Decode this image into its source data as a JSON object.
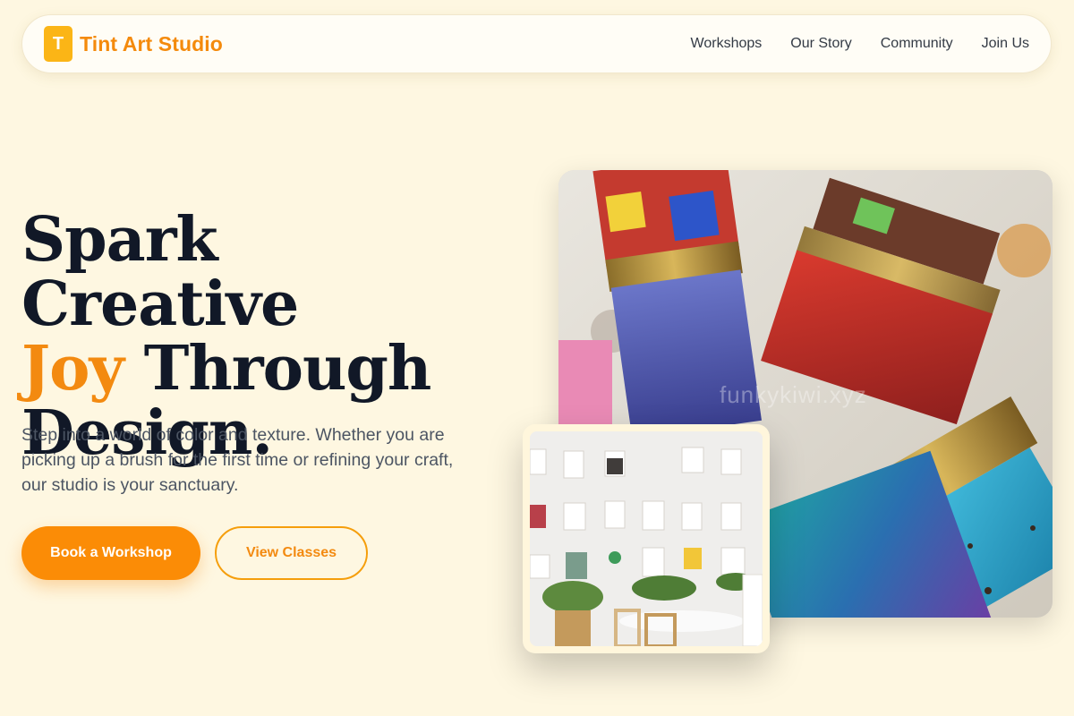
{
  "header": {
    "logo_letter": "T",
    "brand_name": "Tint Art Studio",
    "nav": [
      {
        "label": "Workshops"
      },
      {
        "label": "Our Story"
      },
      {
        "label": "Community"
      },
      {
        "label": "Join Us"
      }
    ]
  },
  "hero": {
    "title_line1": "Spark Creative",
    "title_accent": "Joy",
    "title_line2_rest": " Through",
    "title_line3": "Design.",
    "subtitle": "Step into a world of color and texture. Whether you are picking up a brush for the first time or refining your craft, our studio is your sanctuary.",
    "primary_button": "Book a Workshop",
    "secondary_button": "View Classes"
  },
  "images": {
    "main_watermark": "funkykiwi.xyz"
  },
  "colors": {
    "background": "#fef7e1",
    "accent": "#fb8c06",
    "heading": "#111827",
    "body_text": "#4c5563"
  }
}
